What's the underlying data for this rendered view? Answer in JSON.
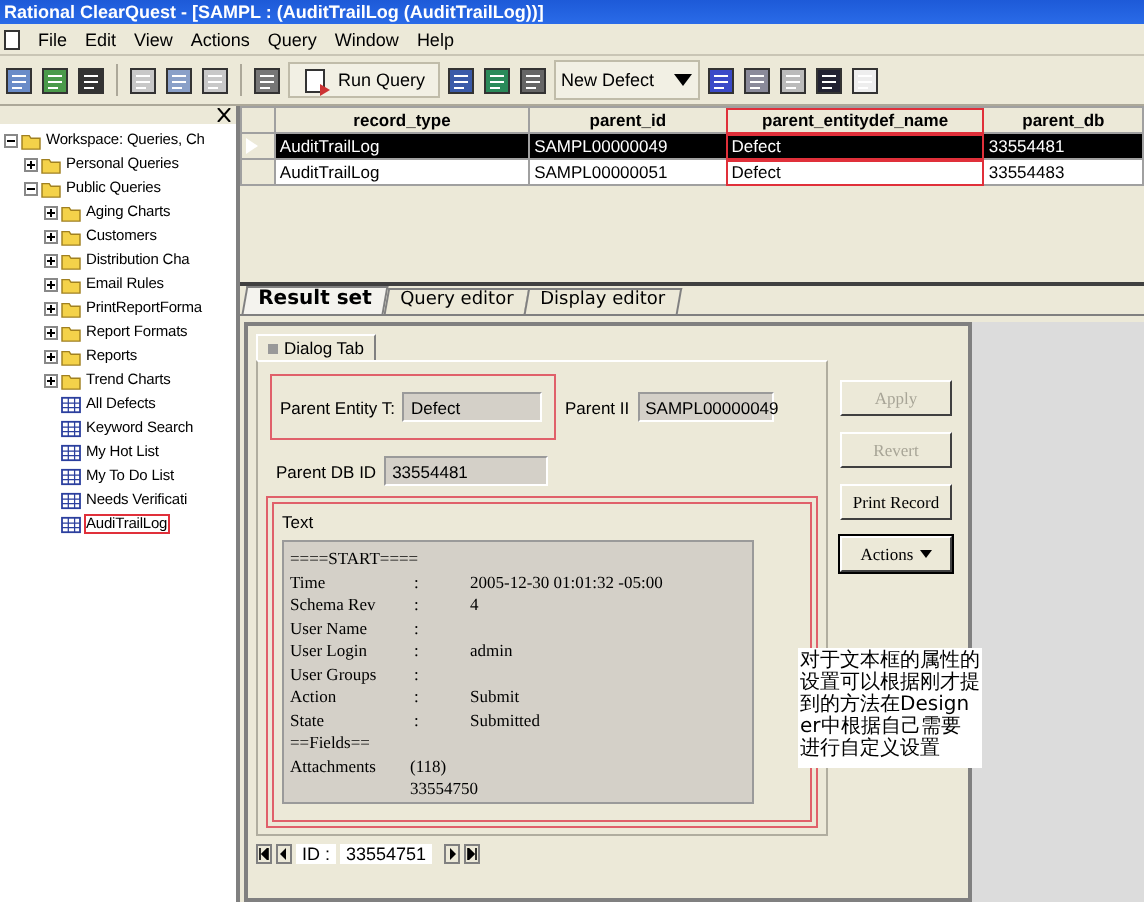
{
  "window": {
    "title": "Rational ClearQuest - [SAMPL : (AuditTrailLog (AuditTrailLog))]"
  },
  "menu": [
    "File",
    "Edit",
    "View",
    "Actions",
    "Query",
    "Window",
    "Help"
  ],
  "toolbar": {
    "run_query": "Run Query",
    "new_defect": "New Defect"
  },
  "tree": [
    {
      "label": "Workspace: Queries, Ch",
      "kind": "folder",
      "expanded": true,
      "children": [
        {
          "label": "Personal Queries",
          "kind": "folder",
          "expanded": false
        },
        {
          "label": "Public Queries",
          "kind": "folder",
          "expanded": true,
          "children": [
            {
              "label": "Aging Charts",
              "kind": "folder",
              "expanded": false
            },
            {
              "label": "Customers",
              "kind": "folder",
              "expanded": false
            },
            {
              "label": "Distribution Cha",
              "kind": "folder",
              "expanded": false
            },
            {
              "label": "Email Rules",
              "kind": "folder",
              "expanded": false
            },
            {
              "label": "PrintReportForma",
              "kind": "folder",
              "expanded": false
            },
            {
              "label": "Report Formats",
              "kind": "folder",
              "expanded": false
            },
            {
              "label": "Reports",
              "kind": "folder",
              "expanded": false
            },
            {
              "label": "Trend Charts",
              "kind": "folder",
              "expanded": false
            },
            {
              "label": "All Defects",
              "kind": "query",
              "annotated": false
            },
            {
              "label": "Keyword Search",
              "kind": "query",
              "annotated": false
            },
            {
              "label": "My Hot List",
              "kind": "query",
              "annotated": false
            },
            {
              "label": "My To Do List",
              "kind": "query",
              "annotated": false
            },
            {
              "label": "Needs Verificati",
              "kind": "query",
              "annotated": false
            },
            {
              "label": "AudiTrailLog",
              "kind": "query",
              "annotated": true
            }
          ]
        }
      ]
    }
  ],
  "table": {
    "columns": [
      {
        "label": "record_type",
        "annotated": false
      },
      {
        "label": "parent_id",
        "annotated": false
      },
      {
        "label": "parent_entitydef_name",
        "annotated": true
      },
      {
        "label": "parent_db",
        "annotated": false
      }
    ],
    "rows": [
      {
        "selected": true,
        "cells": [
          "AuditTrailLog",
          "SAMPL00000049",
          "Defect",
          "33554481"
        ]
      },
      {
        "selected": false,
        "cells": [
          "AuditTrailLog",
          "SAMPL00000051",
          "Defect",
          "33554483"
        ]
      }
    ]
  },
  "tabs": [
    {
      "label": "Result set",
      "selected": true
    },
    {
      "label": "Query editor",
      "selected": false
    },
    {
      "label": "Display editor",
      "selected": false
    }
  ],
  "form": {
    "tab": "Dialog Tab",
    "parent_entity": {
      "label": "Parent Entity T:",
      "value": "Defect"
    },
    "parent_id": {
      "label": "Parent II",
      "value": "SAMPL00000049"
    },
    "parent_db_id": {
      "label": "Parent DB ID",
      "value": "33554481"
    },
    "text_label": "Text",
    "text_lines": [
      {
        "label": "====START===="
      },
      {
        "label": "Time",
        "sep": ":",
        "value": "2005-12-30 01:01:32 -05:00"
      },
      {
        "label": "Schema Rev",
        "sep": ":",
        "value": "4"
      },
      {
        "label": "User Name",
        "sep": ":"
      },
      {
        "label": "User Login",
        "sep": ":",
        "value": "admin"
      },
      {
        "label": "User Groups",
        "sep": ":"
      },
      {
        "label": "Action",
        "sep": ":",
        "value": "Submit"
      },
      {
        "label": "State",
        "sep": ":",
        "value": "Submitted"
      },
      {
        "label": "==Fields=="
      },
      {
        "label": "Attachments",
        "count": "(118)"
      },
      {
        "count": "33554750"
      }
    ],
    "buttons": [
      {
        "label": "Apply",
        "disabled": true
      },
      {
        "label": "Revert",
        "disabled": true
      },
      {
        "label": "Print Record",
        "disabled": false
      },
      {
        "label": "Actions",
        "disabled": false,
        "menu": true
      }
    ],
    "nav": {
      "label": "ID :",
      "value": "33554751"
    }
  },
  "note": "对于文本框的属性的设置可以根据刚才提到的方法在Designer中根据自己需要进行自定义设置"
}
